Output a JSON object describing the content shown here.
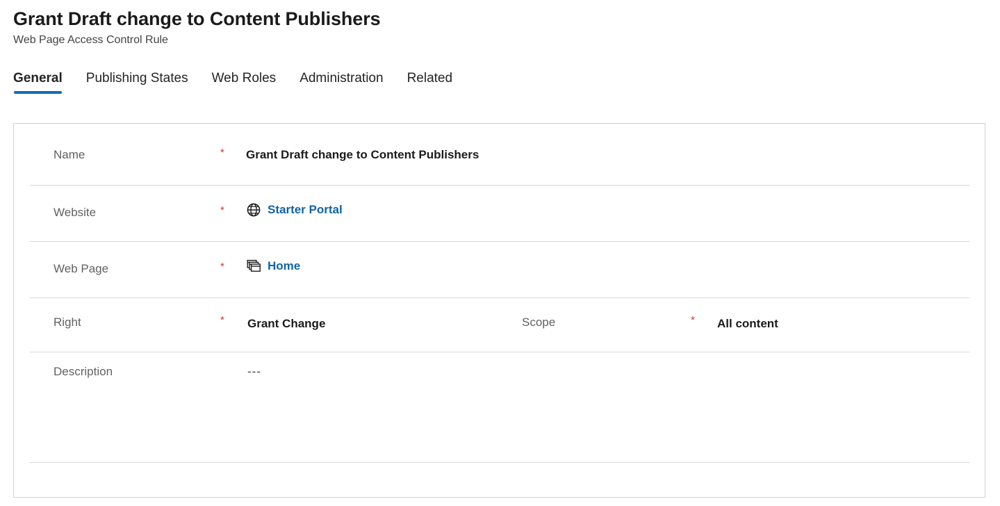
{
  "header": {
    "title": "Grant Draft change to Content Publishers",
    "subtitle": "Web Page Access Control Rule"
  },
  "tabs": [
    {
      "label": "General",
      "active": true
    },
    {
      "label": "Publishing States",
      "active": false
    },
    {
      "label": "Web Roles",
      "active": false
    },
    {
      "label": "Administration",
      "active": false
    },
    {
      "label": "Related",
      "active": false
    }
  ],
  "form": {
    "required_marker": "*",
    "rows": [
      {
        "label": "Name",
        "required": true,
        "value": "Grant Draft change to Content Publishers",
        "type": "text"
      },
      {
        "label": "Website",
        "required": true,
        "value": "Starter Portal",
        "type": "lookup",
        "icon": "globe-icon"
      },
      {
        "label": "Web Page",
        "required": true,
        "value": "Home",
        "type": "lookup",
        "icon": "web-page-icon"
      },
      {
        "label": "Right",
        "required": true,
        "value": "Grant Change",
        "type": "text",
        "second": {
          "label": "Scope",
          "required": true,
          "value": "All content"
        }
      },
      {
        "label": "Description",
        "required": false,
        "value": "---",
        "type": "text-plain"
      }
    ]
  },
  "colors": {
    "accent": "#0f6cbd",
    "link": "#1264a3",
    "required": "#d13438",
    "label": "#616161",
    "value": "#1b1b1b",
    "border": "#d1d1d1",
    "separator": "#d9d9d9"
  }
}
